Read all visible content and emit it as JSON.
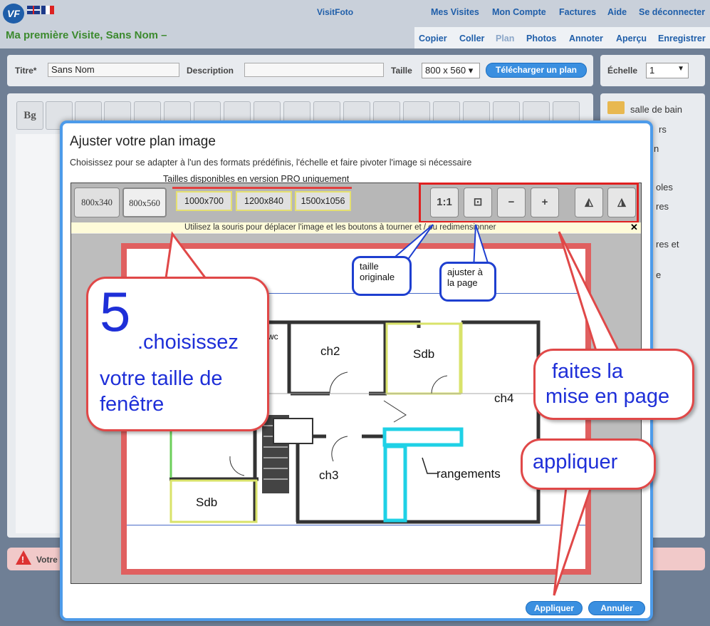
{
  "app": {
    "brand": "VisitFoto",
    "logo_text": "VF",
    "nav": [
      "Mes Visites",
      "Mon Compte",
      "Factures",
      "Aide",
      "Se déconnecter"
    ],
    "visit_title": "Ma première Visite, Sans Nom –",
    "tabs": [
      "Copier",
      "Coller",
      "Plan",
      "Photos",
      "Annoter",
      "Aperçu",
      "Enregistrer"
    ],
    "active_tab": "Plan"
  },
  "form": {
    "title_label": "Titre*",
    "title_value": "Sans Nom",
    "description_label": "Description",
    "description_value": "",
    "size_label": "Taille",
    "size_value": "800 x 560 ▾",
    "upload_button": "Télécharger un plan",
    "scale_label": "Échelle",
    "scale_value": "1"
  },
  "toolbar": {
    "bg_label": "Bg"
  },
  "side": {
    "items": [
      "salle de bain",
      "rs",
      "n",
      "oles",
      "res",
      "res et",
      "e"
    ]
  },
  "alert": {
    "text": "Votre"
  },
  "dialog": {
    "title": "Ajuster votre plan image",
    "subtitle": "Choisissez pour se adapter à l'un des formats prédéfinis, l'échelle et faire pivoter l'image si nécessaire",
    "pro_note": "Tailles disponibles en version PRO uniquement",
    "sizes": [
      "800x340",
      "800x560"
    ],
    "pro_sizes": [
      "1000x700",
      "1200x840",
      "1500x1056"
    ],
    "controls": {
      "original": "1:1",
      "fit": "⊡",
      "zoom_out": "−",
      "zoom_in": "+",
      "rotate_left": "◭",
      "rotate_right": "◮"
    },
    "hint": "Utilisez la souris pour déplacer l'image et les boutons à tourner et / ou redimensionner",
    "hint_close": "✕",
    "apply_button": "Appliquer",
    "cancel_button": "Annuler"
  },
  "plan": {
    "rooms": [
      "ch2",
      "Sdb",
      "ch4",
      "ch3",
      "Sdb",
      "rangements",
      "wc"
    ]
  },
  "callouts": {
    "step_number": "5",
    "step_line1": ".choisissez",
    "step_line2": "votre taille de",
    "step_line3": "fenêtre",
    "original_size": [
      "taille",
      "originale"
    ],
    "fit_page": [
      "ajuster à",
      "la page"
    ],
    "layout": [
      "faites la",
      "mise en page"
    ],
    "apply": "appliquer"
  }
}
